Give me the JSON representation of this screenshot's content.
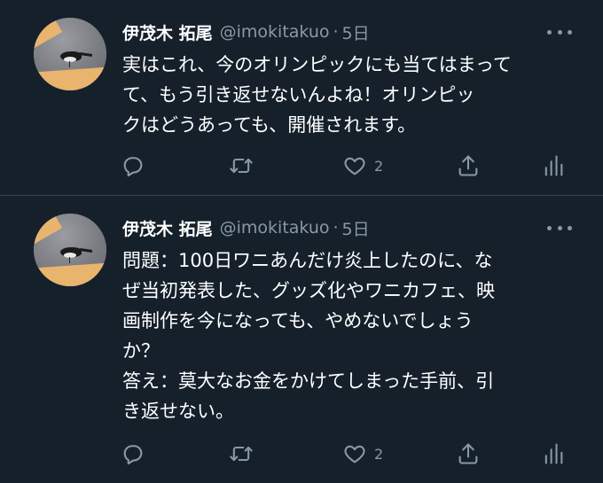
{
  "tweets": [
    {
      "author_name": "伊茂木 拓尾",
      "handle": "@imokitakuo",
      "separator": "·",
      "time": "5日",
      "text": "実はこれ、今のオリンピックにも当てはまって\nて、もう引き返せないんよね！オリンピッ\nクはどうあっても、開催されます。",
      "like_count": "2"
    },
    {
      "author_name": "伊茂木 拓尾",
      "handle": "@imokitakuo",
      "separator": "·",
      "time": "5日",
      "text": "問題：100日ワニあんだけ炎上したのに、な\nぜ当初発表した、グッズ化やワニカフェ、映\n画制作を今になっても、やめないでしょう\nか？\n答え：莫大なお金をかけてしまった手前、引\nき返せない。",
      "like_count": "2"
    }
  ],
  "icons": {
    "reply": "reply-icon",
    "retweet": "retweet-icon",
    "like": "heart-icon",
    "share": "share-icon",
    "analytics": "analytics-icon",
    "more": "more-icon"
  },
  "colors": {
    "background": "#15202b",
    "muted": "#8899a6",
    "divider": "#38444d",
    "text": "#ffffff"
  }
}
